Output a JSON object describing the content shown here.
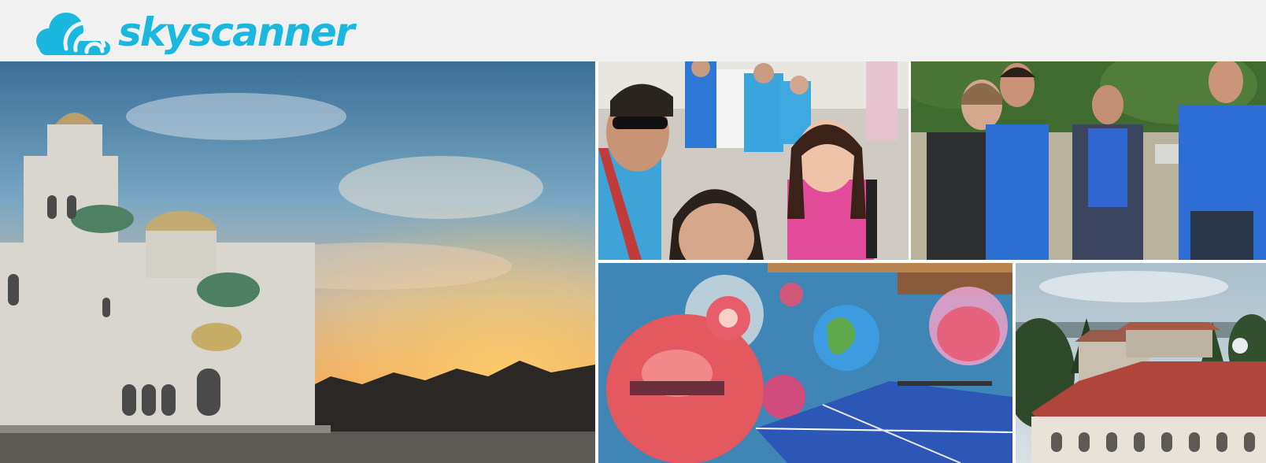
{
  "header": {
    "brand_name": "skyscanner",
    "logo_icon": "cloud-logo-icon",
    "brand_color": "#1ab7de",
    "background": "#f1f1f1"
  },
  "gallery": {
    "photos": [
      {
        "subject": "cathedral-sunset"
      },
      {
        "subject": "team-selfie"
      },
      {
        "subject": "team-park"
      },
      {
        "subject": "astronaut-mural-ping-pong"
      },
      {
        "subject": "city-rooftops"
      }
    ]
  }
}
